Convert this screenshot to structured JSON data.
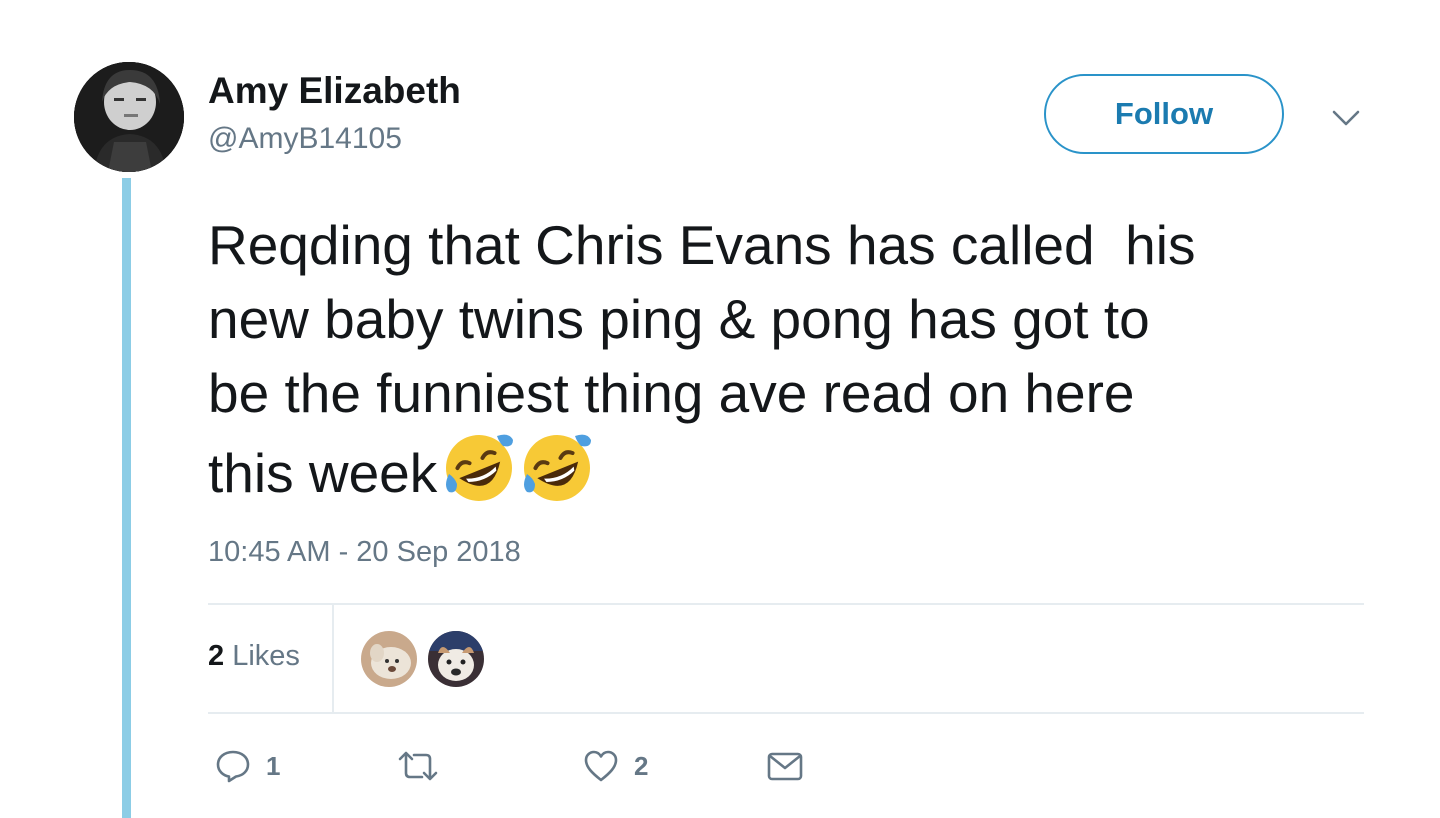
{
  "tweet": {
    "author": {
      "name": "Amy Elizabeth",
      "handle": "@AmyB14105"
    },
    "follow_label": "Follow",
    "text_lines": [
      "Reqding that Chris Evans has called  his",
      "new baby twins ping & pong has got to",
      "be the funniest thing ave read on here",
      "this week"
    ],
    "emojis": [
      "rolling-on-floor-laughing",
      "rolling-on-floor-laughing"
    ],
    "timestamp": "10:45 AM - 20 Sep 2018",
    "stats": {
      "likes_count": "2",
      "likes_label": "Likes"
    },
    "actions": {
      "reply_count": "1",
      "retweet_count": "",
      "like_count": "2"
    }
  },
  "colors": {
    "thread_line": "#8ccde6",
    "follow_accent": "#1b7bb0",
    "secondary_text": "#657786",
    "divider": "#e6ecf0"
  },
  "icons": {
    "caret": "chevron-down-icon",
    "reply": "reply-icon",
    "retweet": "retweet-icon",
    "like": "heart-icon",
    "dm": "envelope-icon"
  }
}
